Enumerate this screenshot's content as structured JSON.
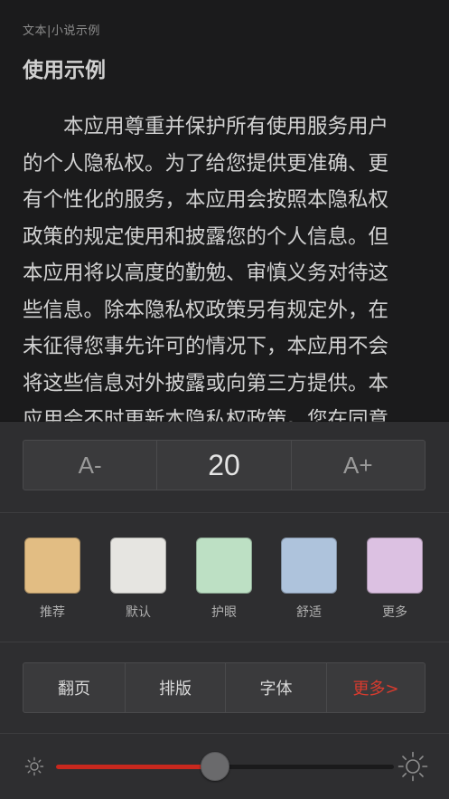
{
  "reader": {
    "breadcrumb": "文本|小说示例",
    "chapter_title": "使用示例",
    "lines": [
      "本应用尊重并保护所有使用服务用户",
      "的个人隐私权。为了给您提供更准确、更",
      "有个性化的服务，本应用会按照本隐私权",
      "政策的规定使用和披露您的个人信息。但",
      "本应用将以高度的勤勉、审慎义务对待这",
      "些信息。除本隐私权政策另有规定外，在",
      "未征得您事先许可的情况下，本应用不会",
      "将这些信息对外披露或向第三方提供。本",
      "应用会不时更新本隐私权政策。您在同意"
    ]
  },
  "font_size": {
    "decrease_label": "A-",
    "value": "20",
    "increase_label": "A+"
  },
  "themes": [
    {
      "label": "推荐",
      "color": "#e2bd83"
    },
    {
      "label": "默认",
      "color": "#e6e5e1"
    },
    {
      "label": "护眼",
      "color": "#bde0c4"
    },
    {
      "label": "舒适",
      "color": "#aec3dc"
    },
    {
      "label": "更多",
      "color": "#dcc1e2"
    }
  ],
  "tabs": [
    {
      "label": "翻页",
      "color": "#d8d8d8"
    },
    {
      "label": "排版",
      "color": "#d8d8d8"
    },
    {
      "label": "字体",
      "color": "#d8d8d8"
    },
    {
      "label": "更多>",
      "color": "#d83b2e"
    }
  ],
  "brightness": {
    "level": 0.47,
    "accent_color": "#c8281e",
    "icon_low": "sun-small-icon",
    "icon_high": "sun-large-icon"
  }
}
